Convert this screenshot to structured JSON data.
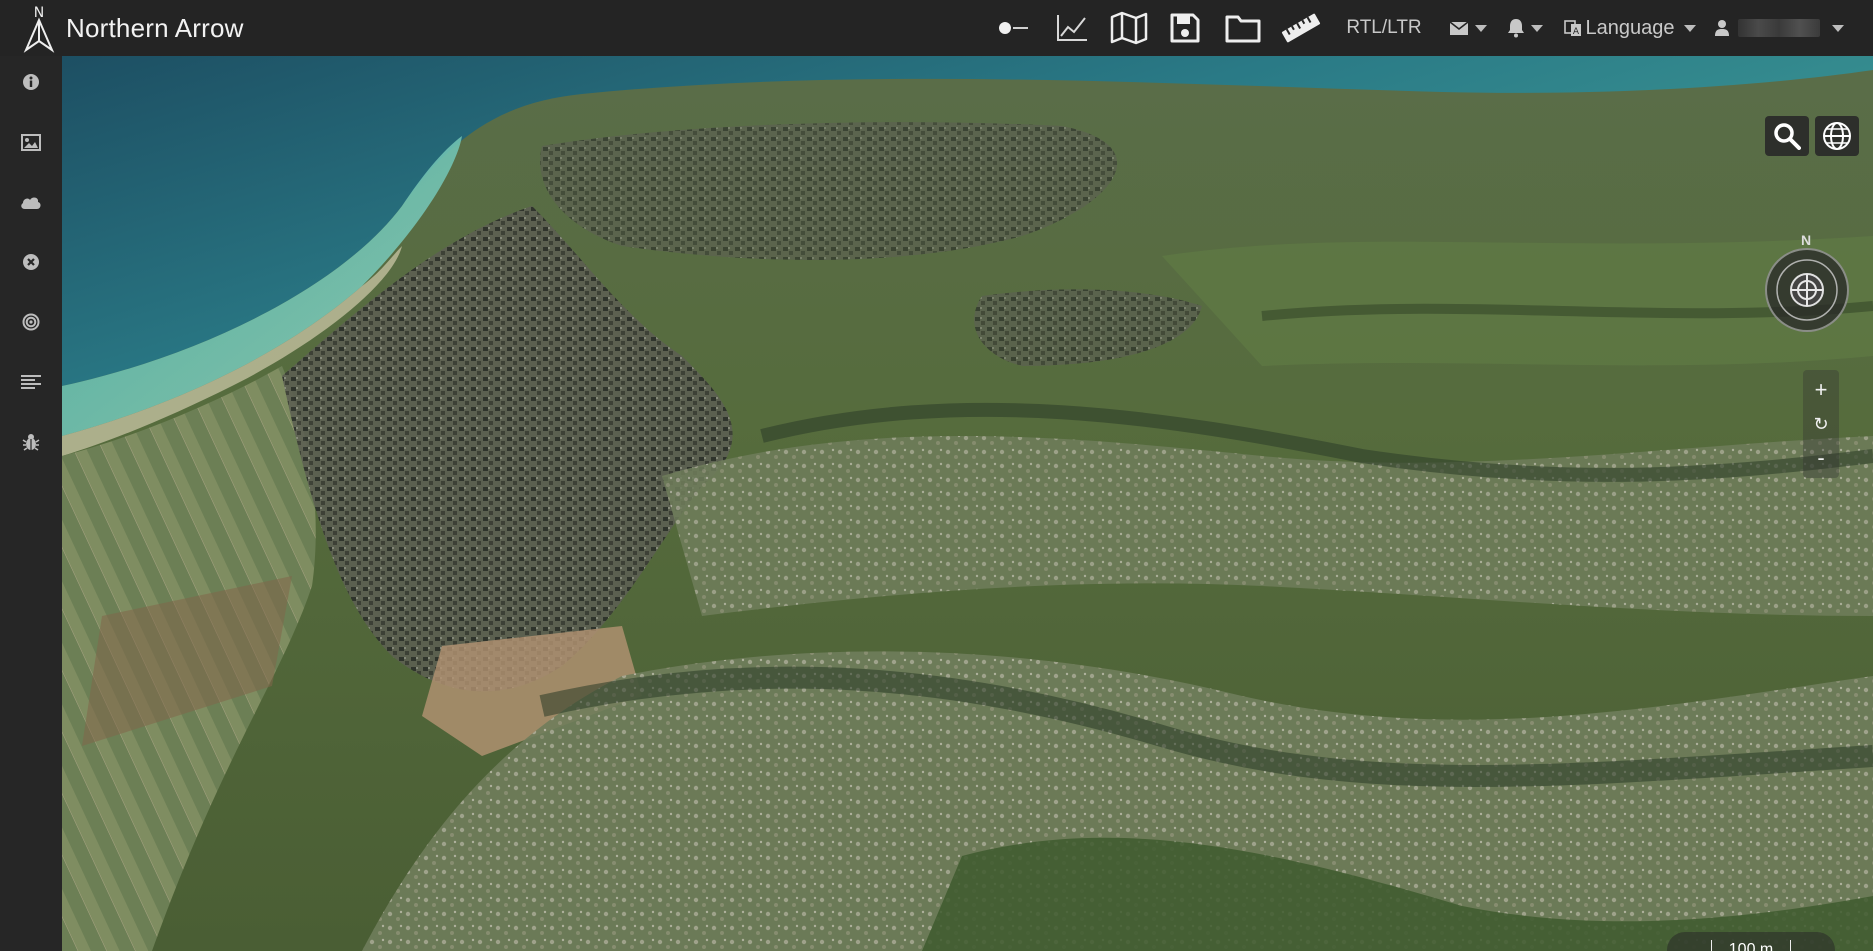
{
  "app": {
    "title": "Northern Arrow",
    "logo_letter": "N"
  },
  "toolbar": {
    "icons": [
      "toggle-switch-icon",
      "line-chart-icon",
      "map-icon",
      "save-icon",
      "folder-icon",
      "ruler-icon"
    ],
    "rtl_label": "RTL/LTR",
    "mail_icon": "envelope-icon",
    "bell_icon": "bell-icon",
    "language_label": "Language",
    "language_icon": "translate-icon",
    "user_icon": "user-icon"
  },
  "sidebar": {
    "items": [
      {
        "name": "info",
        "icon": "info-circle-icon"
      },
      {
        "name": "images",
        "icon": "image-icon"
      },
      {
        "name": "weather",
        "icon": "cloud-icon"
      },
      {
        "name": "clear",
        "icon": "times-circle-icon"
      },
      {
        "name": "target",
        "icon": "bullseye-icon"
      },
      {
        "name": "layers-list",
        "icon": "align-left-icon"
      },
      {
        "name": "debug",
        "icon": "bug-icon"
      }
    ]
  },
  "map_controls": {
    "compass_label": "N",
    "zoom_in_label": "+",
    "reset_label": "↻",
    "zoom_out_label": "-",
    "scale_label": "100 m"
  },
  "colors": {
    "topbar": "#242424",
    "sidebar": "#262626",
    "sea": "#1f6a78",
    "shore": "#52b1a9",
    "terrain": "#4f6a3a"
  }
}
